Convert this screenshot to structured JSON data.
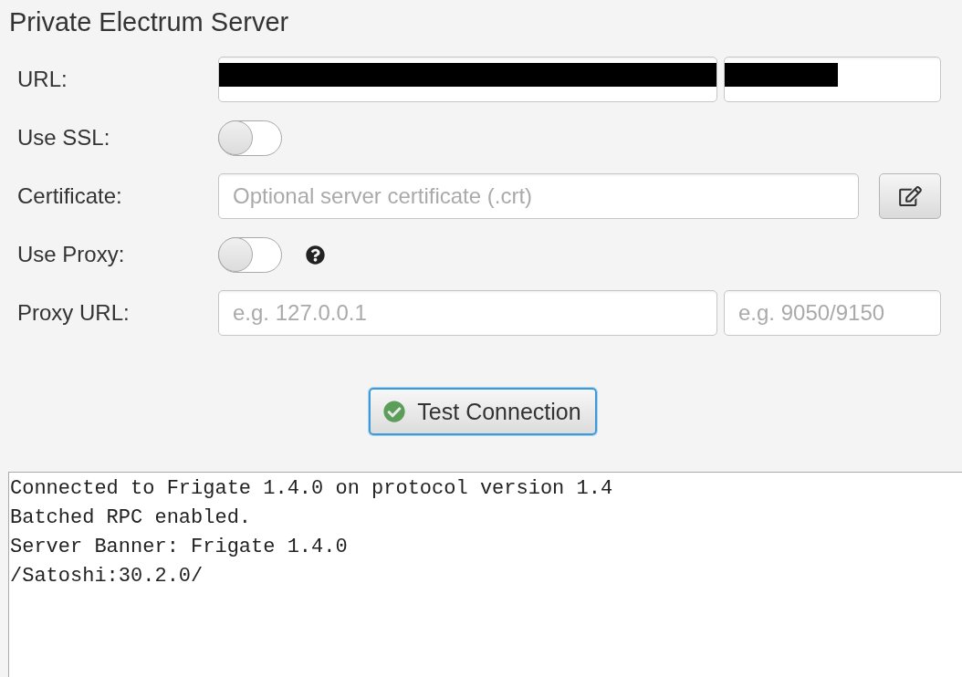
{
  "title": "Private Electrum Server",
  "form": {
    "rows": [
      {
        "kind": "hostport",
        "label": "URL:",
        "redacted": true
      },
      {
        "kind": "toggle",
        "label": "Use SSL:",
        "on": false
      },
      {
        "kind": "file",
        "label": "Certificate:",
        "placeholder": "Optional server certificate (.crt)"
      },
      {
        "kind": "toggle",
        "label": "Use Proxy:",
        "on": false,
        "help": true
      },
      {
        "kind": "hostport",
        "label": "Proxy URL:",
        "host_placeholder": "e.g. 127.0.0.1",
        "port_placeholder": "e.g. 9050/9150"
      }
    ]
  },
  "test_button": {
    "label": "Test Connection",
    "focused": true
  },
  "log": {
    "lines": [
      "Connected to Frigate 1.4.0 on protocol version 1.4",
      "Batched RPC enabled.",
      "Server Banner: Frigate 1.4.0",
      "/Satoshi:30.2.0/"
    ]
  }
}
